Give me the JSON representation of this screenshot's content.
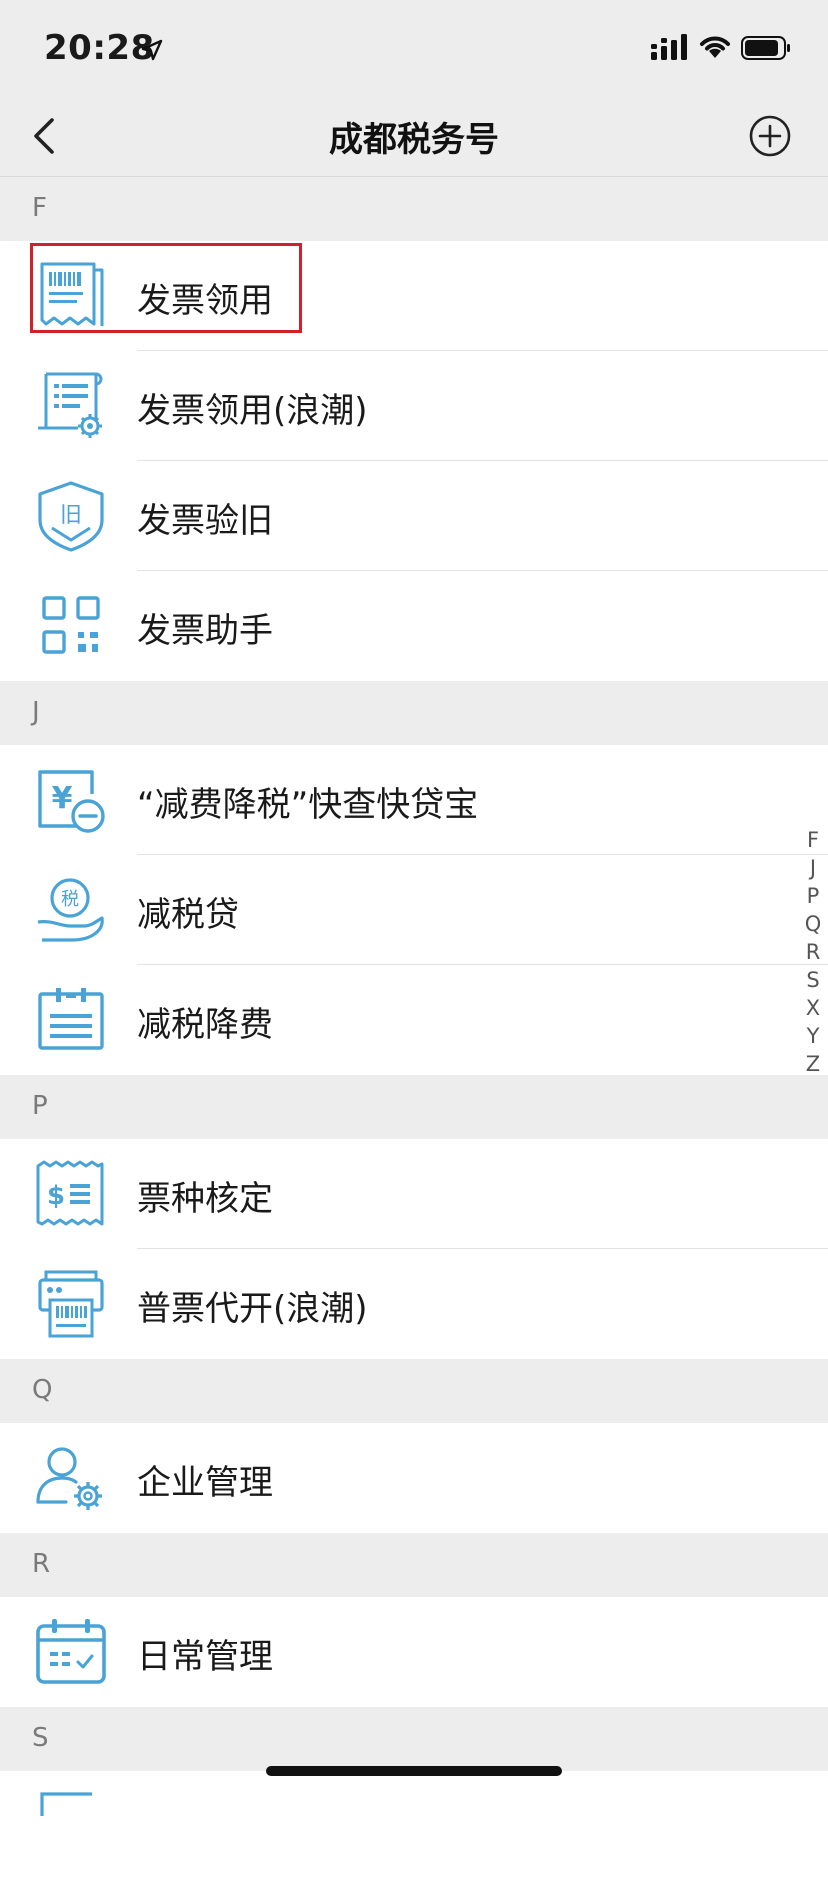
{
  "status_bar": {
    "time": "20:28"
  },
  "nav": {
    "title": "成都税务号"
  },
  "sections": [
    {
      "letter": "F",
      "items": [
        {
          "label": "发票领用",
          "icon": "invoice-receipt-icon"
        },
        {
          "label": "发票领用(浪潮)",
          "icon": "invoice-gear-icon"
        },
        {
          "label": "发票验旧",
          "icon": "shield-old-icon"
        },
        {
          "label": "发票助手",
          "icon": "qr-code-icon"
        }
      ]
    },
    {
      "letter": "J",
      "items": [
        {
          "label": "“减费降税”快查快贷宝",
          "icon": "yen-minus-icon"
        },
        {
          "label": "减税贷",
          "icon": "tax-coin-hand-icon"
        },
        {
          "label": "减税降费",
          "icon": "calendar-list-icon"
        }
      ]
    },
    {
      "letter": "P",
      "items": [
        {
          "label": "票种核定",
          "icon": "dollar-receipt-icon"
        },
        {
          "label": "普票代开(浪潮)",
          "icon": "printer-icon"
        }
      ]
    },
    {
      "letter": "Q",
      "items": [
        {
          "label": "企业管理",
          "icon": "user-gear-icon"
        }
      ]
    },
    {
      "letter": "R",
      "items": [
        {
          "label": "日常管理",
          "icon": "calendar-check-icon"
        }
      ]
    },
    {
      "letter": "S",
      "items": []
    }
  ],
  "index_letters": [
    "F",
    "J",
    "P",
    "Q",
    "R",
    "S",
    "X",
    "Y",
    "Z"
  ],
  "colors": {
    "icon_blue": "#4aa3d6",
    "highlight_red": "#d0202a"
  }
}
